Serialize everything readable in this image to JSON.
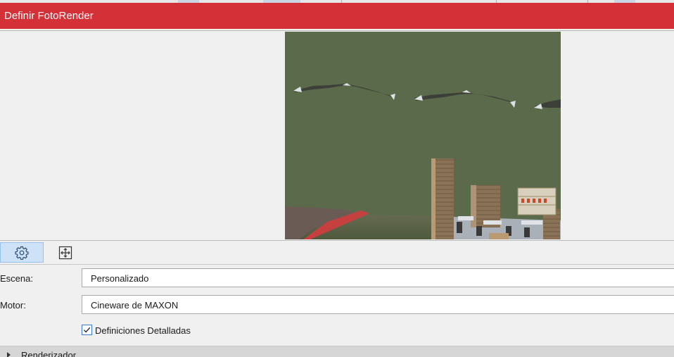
{
  "window": {
    "title": "Definir FotoRender"
  },
  "toolbar": {
    "buttons": [
      {
        "icon": "gear-icon",
        "active": true
      },
      {
        "icon": "crop-size-icon",
        "active": false
      }
    ]
  },
  "form": {
    "scene": {
      "label": "Escena:",
      "value": "Personalizado"
    },
    "engine": {
      "label": "Motor:",
      "value": "Cineware de MAXON"
    },
    "detailed": {
      "label": "Definiciones Detalladas",
      "checked": true
    }
  },
  "sections": [
    {
      "label": "Renderizador",
      "expanded": false
    }
  ],
  "colors": {
    "titlebar": "#d33038",
    "active_button": "#cde2f7",
    "preview_wall": "#5b6a4a"
  }
}
